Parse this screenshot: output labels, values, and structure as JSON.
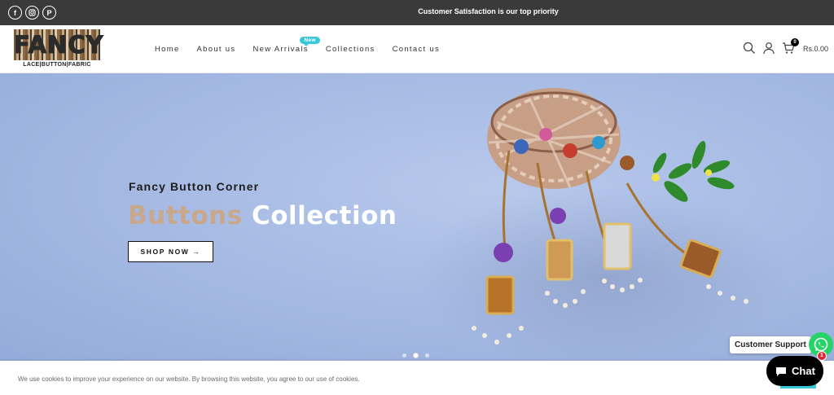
{
  "topbar": {
    "announcement": "Customer Satisfaction is our top priority",
    "social": [
      {
        "icon": "facebook-icon",
        "glyph": "f"
      },
      {
        "icon": "instagram-icon",
        "glyph": ""
      },
      {
        "icon": "pinterest-icon",
        "glyph": "P"
      }
    ]
  },
  "header": {
    "logo": {
      "word": "FANCY",
      "tagline": "LACE|BUTTON|FABRIC"
    },
    "nav": [
      {
        "label": "Home"
      },
      {
        "label": "About us"
      },
      {
        "label": "New Arrivals",
        "badge": "New"
      },
      {
        "label": "Collections"
      },
      {
        "label": "Contact us"
      }
    ],
    "cart_count": "0",
    "cart_total": "Rs.0.00"
  },
  "hero": {
    "kicker": "Fancy Button Corner",
    "headline_accent": "Buttons",
    "headline_main": "Collection",
    "cta": "SHOP NOW →",
    "slides": 3,
    "active_slide": 2
  },
  "cookie": {
    "message": "We use cookies to improve your experience on our website. By browsing this website, you agree to our use of cookies."
  },
  "floating": {
    "support_label": "Customer Support",
    "chat_label": "Chat",
    "chat_notification": "1"
  },
  "colors": {
    "topbar": "#3a3a3a",
    "accent": "#3ac7d8",
    "headline_accent": "#c8a78a",
    "whatsapp": "#25d366"
  }
}
